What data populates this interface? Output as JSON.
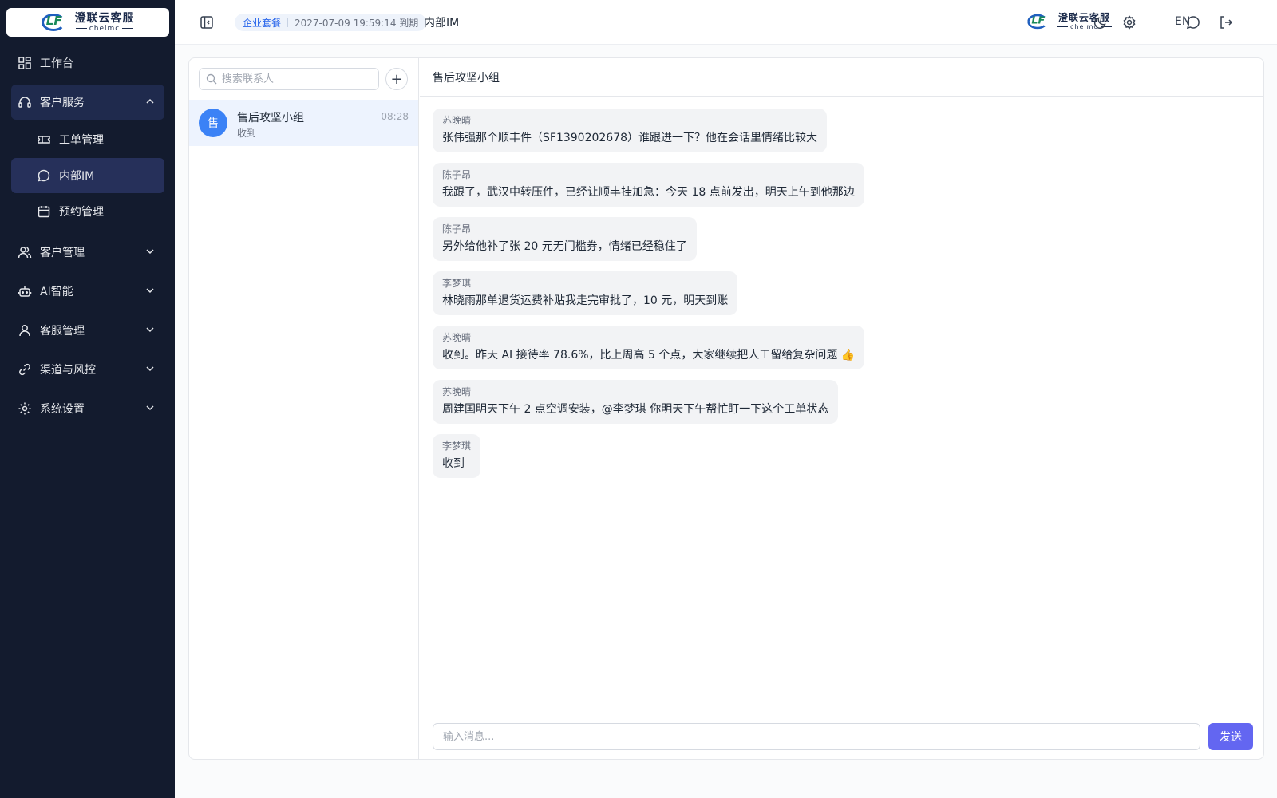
{
  "brand": {
    "name": "澄联云客服",
    "sub": "cheimc"
  },
  "sidebar": {
    "items": [
      {
        "label": "工作台"
      },
      {
        "label": "客户服务"
      },
      {
        "label": "工单管理"
      },
      {
        "label": "内部IM"
      },
      {
        "label": "预约管理"
      },
      {
        "label": "客户管理"
      },
      {
        "label": "AI智能"
      },
      {
        "label": "客服管理"
      },
      {
        "label": "渠道与风控"
      },
      {
        "label": "系统设置"
      }
    ]
  },
  "header": {
    "plan": "企业套餐",
    "expiry": "2027-07-09 19:59:14 到期",
    "page": "内部IM",
    "lang": "EN"
  },
  "contacts": {
    "search_placeholder": "搜索联系人",
    "add": "+",
    "list": [
      {
        "avatar": "售",
        "name": "售后攻坚小组",
        "last": "收到",
        "time": "08:28"
      }
    ]
  },
  "chat": {
    "title": "售后攻坚小组",
    "messages": [
      {
        "sender": "苏晚晴",
        "text": "张伟强那个顺丰件（SF1390202678）谁跟进一下？他在会话里情绪比较大"
      },
      {
        "sender": "陈子昂",
        "text": "我跟了，武汉中转压件，已经让顺丰挂加急：今天 18 点前发出，明天上午到他那边"
      },
      {
        "sender": "陈子昂",
        "text": "另外给他补了张 20 元无门槛券，情绪已经稳住了"
      },
      {
        "sender": "李梦琪",
        "text": "林晓雨那单退货运费补贴我走完审批了，10 元，明天到账"
      },
      {
        "sender": "苏晚晴",
        "text": "收到。昨天 AI 接待率 78.6%，比上周高 5 个点，大家继续把人工留给复杂问题 👍"
      },
      {
        "sender": "苏晚晴",
        "text": "周建国明天下午 2 点空调安装，@李梦琪 你明天下午帮忙盯一下这个工单状态"
      },
      {
        "sender": "李梦琪",
        "text": "收到"
      }
    ],
    "input_placeholder": "输入消息...",
    "send_label": "发送"
  }
}
